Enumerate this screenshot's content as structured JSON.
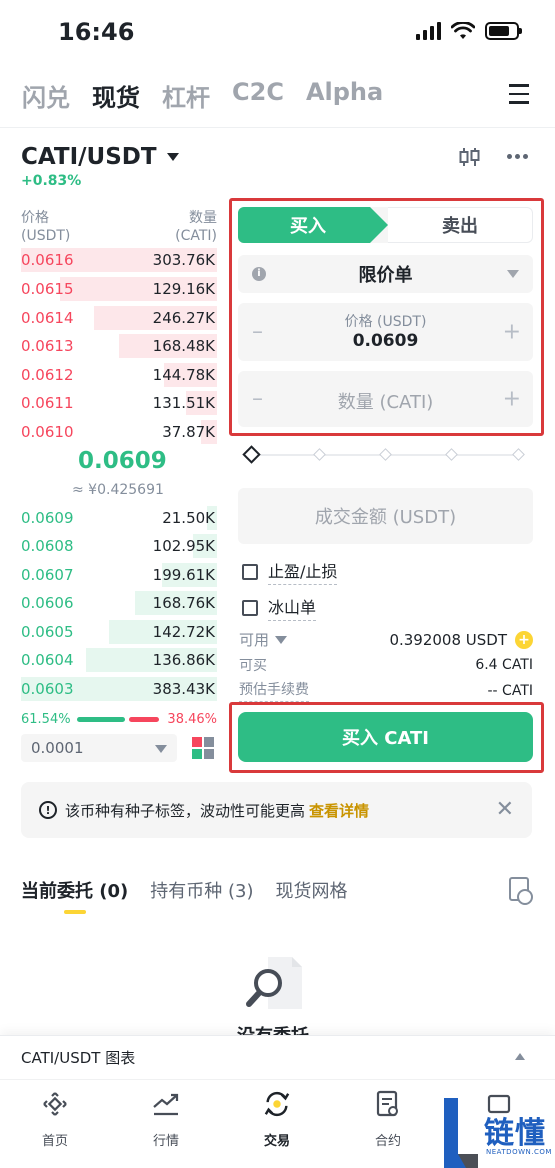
{
  "status": {
    "time": "16:46"
  },
  "top_tabs": [
    "闪兑",
    "现货",
    "杠杆",
    "C2C",
    "Alpha"
  ],
  "pair": {
    "symbol": "CATI/USDT",
    "change": "+0.83%"
  },
  "orderbook": {
    "price_header": "价格",
    "price_unit": "(USDT)",
    "qty_header": "数量",
    "qty_unit": "(CATI)",
    "asks": [
      {
        "price": "0.0616",
        "qty": "303.76K",
        "depth": 1.0
      },
      {
        "price": "0.0615",
        "qty": "129.16K",
        "depth": 0.8
      },
      {
        "price": "0.0614",
        "qty": "246.27K",
        "depth": 0.63
      },
      {
        "price": "0.0613",
        "qty": "168.48K",
        "depth": 0.5
      },
      {
        "price": "0.0612",
        "qty": "144.78K",
        "depth": 0.27
      },
      {
        "price": "0.0611",
        "qty": "131.51K",
        "depth": 0.16
      },
      {
        "price": "0.0610",
        "qty": "37.87K",
        "depth": 0.08
      }
    ],
    "mid_price": "0.0609",
    "mid_fiat": "≈ ¥0.425691",
    "bids": [
      {
        "price": "0.0609",
        "qty": "21.50K",
        "depth": 0.05
      },
      {
        "price": "0.0608",
        "qty": "102.95K",
        "depth": 0.12
      },
      {
        "price": "0.0607",
        "qty": "199.61K",
        "depth": 0.28
      },
      {
        "price": "0.0606",
        "qty": "168.76K",
        "depth": 0.42
      },
      {
        "price": "0.0605",
        "qty": "142.72K",
        "depth": 0.55
      },
      {
        "price": "0.0604",
        "qty": "136.86K",
        "depth": 0.67
      },
      {
        "price": "0.0603",
        "qty": "383.43K",
        "depth": 1.0
      }
    ],
    "buy_ratio": "61.54%",
    "sell_ratio": "38.46%",
    "precision": "0.0001"
  },
  "form": {
    "buy_tab": "买入",
    "sell_tab": "卖出",
    "order_type": "限价单",
    "price_label": "价格 (USDT)",
    "price_value": "0.0609",
    "qty_placeholder": "数量 (CATI)",
    "total_placeholder": "成交金额 (USDT)",
    "tp_sl_label": "止盈/止损",
    "iceberg_label": "冰山单",
    "available_label": "可用",
    "available_value": "0.392008 USDT",
    "can_buy_label": "可买",
    "can_buy_value": "6.4 CATI",
    "fee_label": "预估手续费",
    "fee_value": "-- CATI",
    "buy_button": "买入 CATI"
  },
  "notice": {
    "text": "该币种有种子标签，波动性可能更高",
    "link": "查看详情"
  },
  "orders_tabs": {
    "current": "当前委托 (0)",
    "holdings": "持有币种 (3)",
    "grid": "现货网格"
  },
  "empty_text": "没有委托",
  "chart_bar": "CATI/USDT 图表",
  "bottom_nav": [
    "首页",
    "行情",
    "交易",
    "合约"
  ],
  "watermark": {
    "text": "链懂",
    "sub": "NEATDOWN.COM"
  },
  "colors": {
    "buy": "#2ebd85",
    "sell": "#f6465d",
    "accent": "#fcd535",
    "highlight": "#d9393b"
  }
}
